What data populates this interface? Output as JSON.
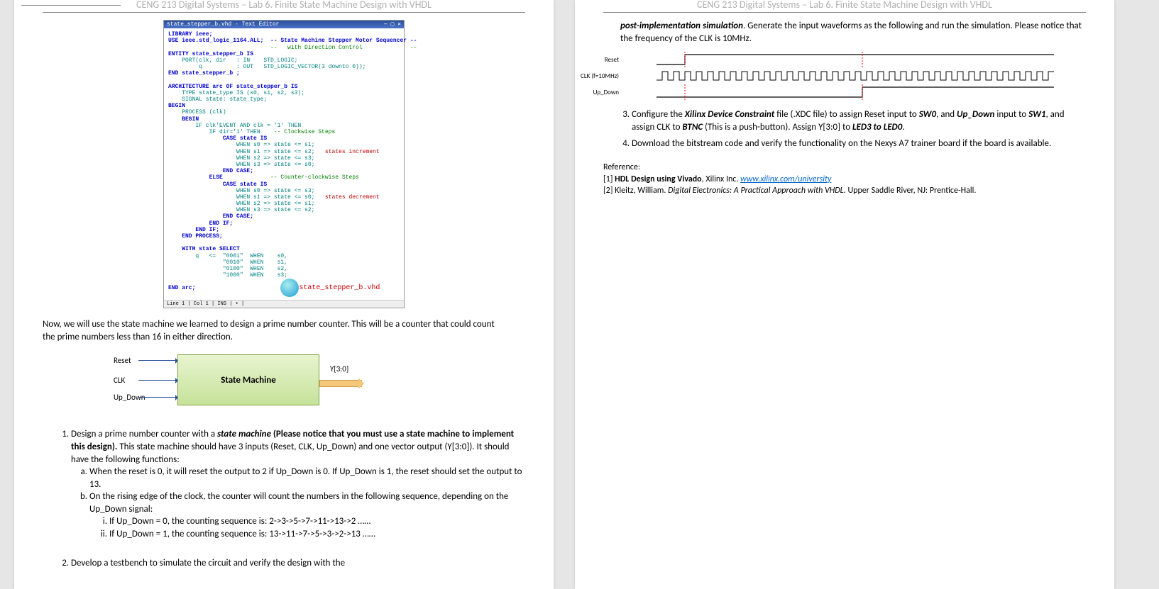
{
  "header": "CENG 213 Digital Systems – Lab 6. Finite State Machine Design with VHDL",
  "editor": {
    "title": "state_stepper_b.vhd - Text Editor",
    "file_label": "state_stepper_b.vhd",
    "status": "Line   1   | Col   1    | INS | • |",
    "annot_inc": "states increment",
    "annot_dec": "states decrement",
    "cmt_cw": "-- Clockwise Steps",
    "cmt_ccw": "-- Counter-clockwise Steps",
    "code": {
      "l1": "LIBRARY ieee;",
      "l2": "USE ieee.std_logic_1164.ALL;  -- State Machine Stepper Motor Sequencer --",
      "l3": "                              --   with Direction Control              --",
      "l4a": "ENTITY state_stepper_b IS",
      "l4b": "    PORT(clk, dir   : IN    STD_LOGIC;",
      "l4c": "         q          : OUT   STD_LOGIC_VECTOR(3 downto 0));",
      "l5": "END state_stepper_b ;",
      "l6": "ARCHITECTURE arc OF state_stepper_b IS",
      "l7": "    TYPE state_type IS (s0, s1, s2, s3);",
      "l8": "    SIGNAL state: state_type;",
      "l9": "BEGIN",
      "l10": "    PROCESS (clk)",
      "l11": "    BEGIN",
      "l12": "        IF clk'EVENT AND clk = '1' THEN",
      "l13": "            IF dir='1' THEN",
      "l14": "                CASE state IS",
      "l15": "                    WHEN s0 => state <= s1;",
      "l16": "                    WHEN s1 => state <= s2;",
      "l17": "                    WHEN s2 => state <= s3;",
      "l18": "                    WHEN s3 => state <= s0;",
      "l19": "                END CASE;",
      "l20": "            ELSE",
      "l21": "                CASE state IS",
      "l22": "                    WHEN s0 => state <= s3;",
      "l23": "                    WHEN s1 => state <= s0;",
      "l24": "                    WHEN s2 => state <= s1;",
      "l25": "                    WHEN s3 => state <= s2;",
      "l26": "                END CASE;",
      "l27": "            END IF;",
      "l28": "        END IF;",
      "l29": "    END PROCESS;",
      "l30": "    WITH state SELECT",
      "l31": "        q   <=  \"0001\"  WHEN    s0,",
      "l32": "                \"0010\"  WHEN    s1,",
      "l33": "                \"0100\"  WHEN    s2,",
      "l34": "                \"1000\"  WHEN    s3;",
      "l35": "END arc;"
    }
  },
  "intro": "Now, we will use the state machine we learned to design a prime number counter. This will be a counter that could count the prime numbers less than 16 in either direction.",
  "diagram": {
    "reset": "Reset",
    "clk": "CLK",
    "updown": "Up_Down",
    "box": "State Machine",
    "out": "Y[3:0]"
  },
  "tasks": {
    "t1a": "Design a prime number counter with a ",
    "t1b": "state machine",
    "t1c": " (Please notice that you must use a state machine to implement this design).",
    "t1d": " This state machine should have 3 inputs (Reset, CLK, Up_Down) and one vector output (Y[3:0]). It should have the following functions:",
    "t1_a": "When the reset is 0, it will reset the output to 2 if Up_Down is 0. If Up_Down is 1, the reset should set the output to 13.",
    "t1_b": "On the rising edge of the clock, the counter will count the numbers in the following sequence, depending on the Up_Down signal:",
    "t1_bi": "If Up_Down = 0, the counting sequence is: 2->3->5->7->11->13->2 ……",
    "t1_bii": "If Up_Down = 1, the counting sequence is:  13->11->7->5->3->2->13 ……",
    "t2": "Develop a testbench to simulate the circuit and verify the design with the"
  },
  "right": {
    "sim1": "post-implementation simulation",
    "sim2": ". Generate the input waveforms as the following and run the simulation. Please notice that the frequency of the CLK is 10MHz.",
    "wf_reset": "Reset",
    "wf_clk": "CLK (f=10MHz)",
    "wf_ud": "Up_Down",
    "t3a": "Configure the ",
    "t3b": "Xilinx Device Constraint",
    "t3c": " file (.XDC file) to assign Reset input to ",
    "t3d": "SW0",
    "t3e": ", and ",
    "t3f": "Up_Down",
    "t3g": " input to ",
    "t3h": "SW1",
    "t3i": ", and assign CLK to ",
    "t3j": "BTNC",
    "t3k": " (This is a push-button). Assign Y[3:0] to ",
    "t3l": "LED3 to LED0",
    "t3m": ".",
    "t4": "Download the bitstream code and verify the functionality on the Nexys A7 trainer board if the board is available.",
    "ref_title": "Reference:",
    "ref1a": "[1] ",
    "ref1b": "HDL Design using Vivado",
    "ref1c": ", Xilinx Inc. ",
    "ref1d": "www.xilinx.com/university",
    "ref2a": "[2] Kleitz, William. ",
    "ref2b": "Digital Electronics: A Practical Approach with VHDL.",
    "ref2c": " Upper Saddle River, NJ: Prentice-Hall."
  }
}
